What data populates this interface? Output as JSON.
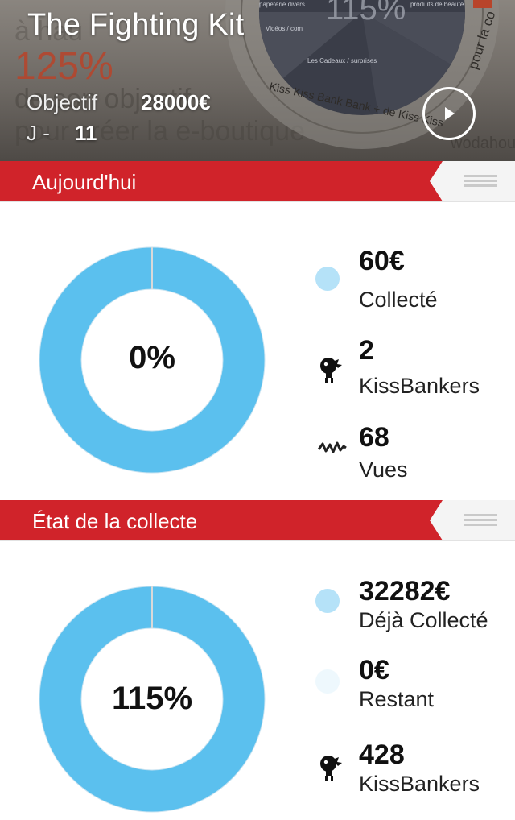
{
  "header": {
    "title": "The Fighting Kit",
    "objectif_label": "Objectif",
    "objectif_value": "28000€",
    "days_label": "J -",
    "days_value": "11",
    "play_icon": "play-icon"
  },
  "today": {
    "title": "Aujourd'hui",
    "chart_percent_label": "0%",
    "progress_fraction": 0,
    "stats": [
      {
        "value": "60€",
        "label": "Collecté",
        "icon": "blue-dot-icon"
      },
      {
        "value": "2",
        "label": "KissBankers",
        "icon": "kissbanker-icon"
      },
      {
        "value": "68",
        "label": "Vues",
        "icon": "activity-wave-icon"
      }
    ]
  },
  "state": {
    "title": "État de la collecte",
    "chart_percent_label": "115%",
    "progress_fraction": 1.0,
    "stats": [
      {
        "value": "32282€",
        "label": "Déjà Collecté",
        "icon": "blue-dot-icon"
      },
      {
        "value": "0€",
        "label": "Restant",
        "icon": "pale-dot-icon"
      },
      {
        "value": "428",
        "label": "KissBankers",
        "icon": "kissbanker-icon"
      }
    ]
  },
  "colors": {
    "ribbon_red": "#d0232a",
    "donut_blue": "#5bc0ee",
    "dot_blue": "#b5e2f8",
    "dot_pale": "#eef8fd",
    "bar_grey": "#f4f4f4"
  }
}
